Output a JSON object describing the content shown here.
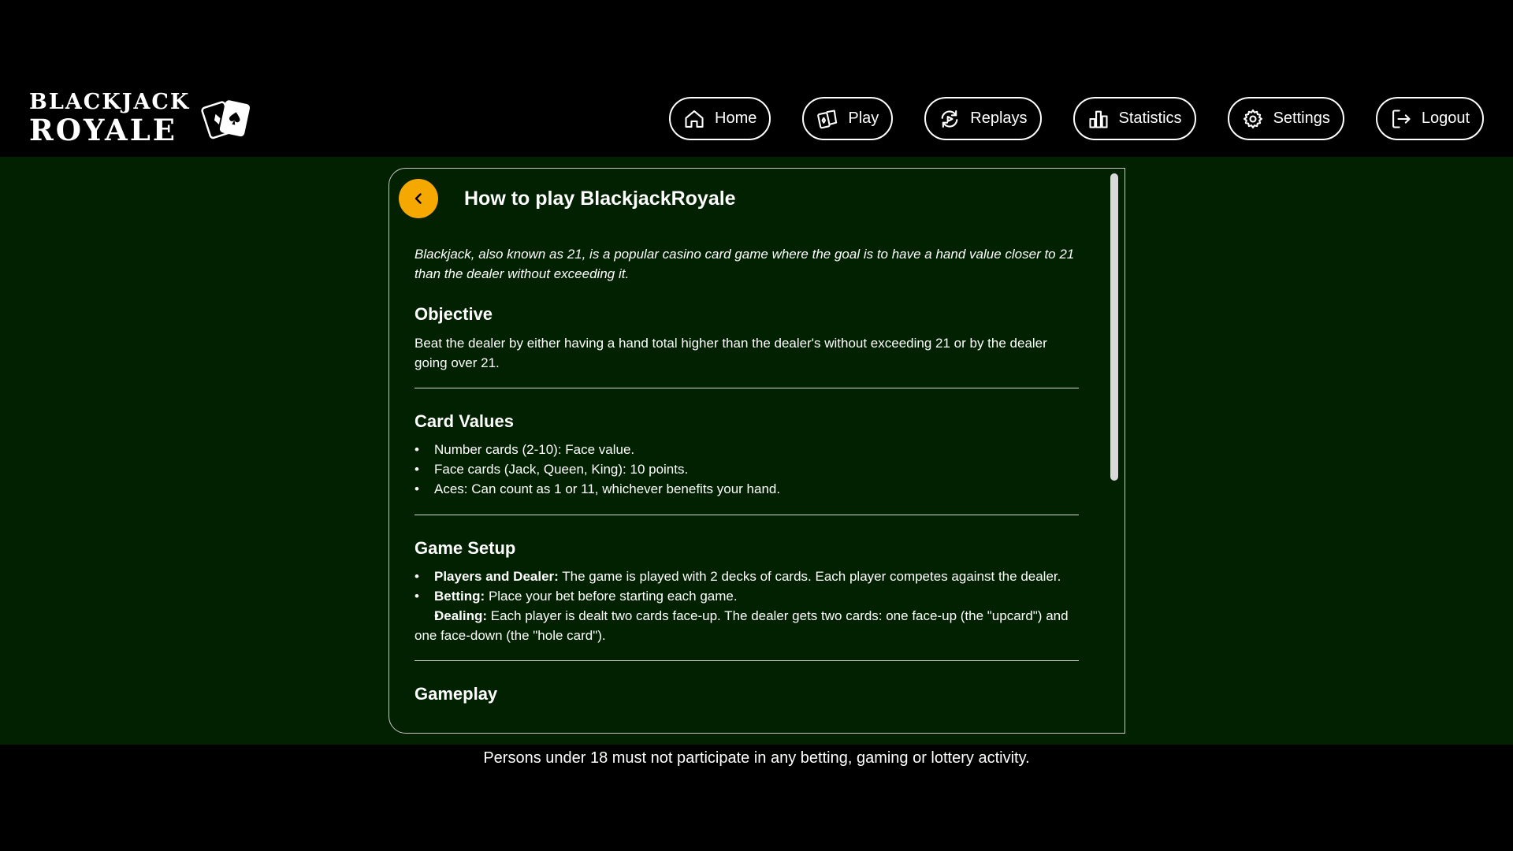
{
  "brand": {
    "line1": "BLACKJACK",
    "line2": "ROYALE"
  },
  "nav": {
    "items": [
      {
        "label": "Home",
        "icon": "home-icon"
      },
      {
        "label": "Play",
        "icon": "cards-icon"
      },
      {
        "label": "Replays",
        "icon": "replay-icon"
      },
      {
        "label": "Statistics",
        "icon": "bar-chart-icon"
      },
      {
        "label": "Settings",
        "icon": "gear-icon"
      },
      {
        "label": "Logout",
        "icon": "logout-icon"
      }
    ]
  },
  "panel": {
    "title": "How to play BlackjackRoyale",
    "intro": "Blackjack, also known as 21, is a popular casino card game where the goal is to have a hand value closer to 21 than the dealer without exceeding it.",
    "sections": {
      "objective": {
        "title": "Objective",
        "text": "Beat the dealer by either having a hand total higher than the dealer's without exceeding 21 or by the dealer going over 21."
      },
      "card_values": {
        "title": "Card Values",
        "items": [
          "Number cards (2-10): Face value.",
          "Face cards (Jack, Queen, King): 10 points.",
          "Aces: Can count as 1 or 11, whichever benefits your hand."
        ]
      },
      "game_setup": {
        "title": "Game Setup",
        "items": [
          {
            "label": "Players and Dealer:",
            "text": " The game is played with 2 decks of cards. Each player competes against the dealer."
          },
          {
            "label": "Betting:",
            "text": " Place your bet before starting each game."
          },
          {
            "label": "Dealing:",
            "text": " Each player is dealt two cards face-up. The dealer gets two cards: one face-up (the \"upcard\") and one face-down (the \"hole card\")."
          }
        ]
      },
      "gameplay": {
        "title": "Gameplay"
      }
    }
  },
  "footer": {
    "text": "Persons under 18 must not participate in any betting, gaming or lottery activity."
  },
  "colors": {
    "accent": "#f5a800",
    "background": "#012100",
    "chrome": "#000000"
  }
}
